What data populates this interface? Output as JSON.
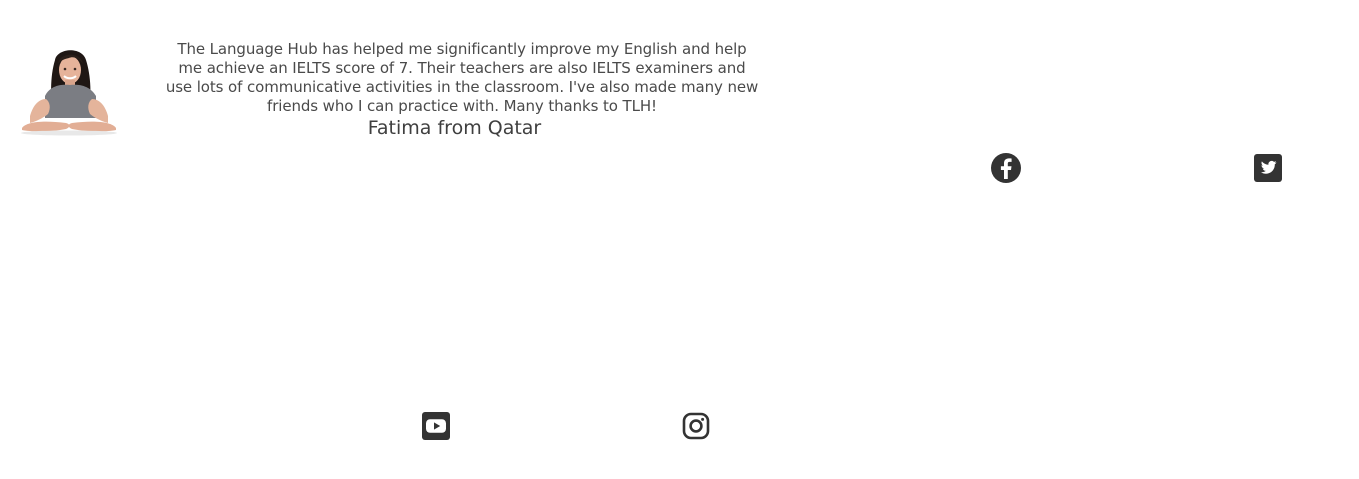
{
  "testimonial": {
    "quote": "The Language Hub has helped me significantly improve my English and help me achieve an IELTS score of 7. Their teachers are also IELTS examiners and use lots of communicative activities in the classroom. I've also made many new friends who I can practice with. Many thanks to TLH!",
    "author": "Fatima from Qatar",
    "avatar_icon": "student-avatar-photo"
  },
  "social": {
    "icons": [
      "facebook-icon",
      "twitter-icon",
      "youtube-icon",
      "instagram-icon"
    ],
    "icon_color": "#333333"
  },
  "colors": {
    "background": "#ffffff",
    "text": "#4a4a4a"
  }
}
